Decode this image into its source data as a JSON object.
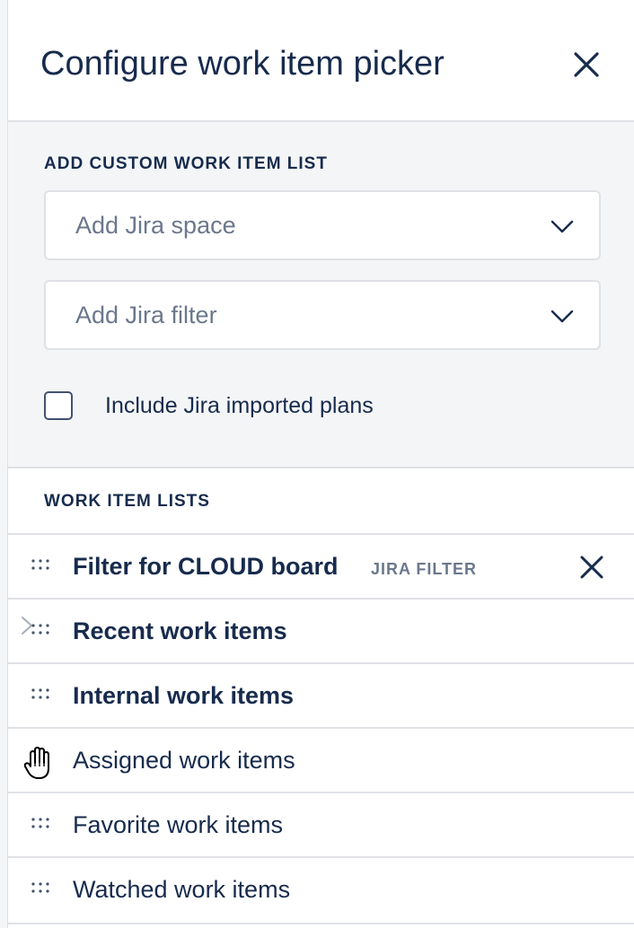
{
  "dialog": {
    "title": "Configure work item picker",
    "close_icon": "close-icon"
  },
  "custom_list": {
    "heading": "ADD CUSTOM WORK ITEM LIST",
    "space_select": {
      "placeholder": "Add Jira space",
      "icon": "chevron-down-icon"
    },
    "filter_select": {
      "placeholder": "Add Jira filter",
      "icon": "chevron-down-icon"
    },
    "include_imported": {
      "label": "Include Jira imported plans",
      "checked": false
    }
  },
  "work_item_lists": {
    "heading": "WORK ITEM LISTS",
    "items": [
      {
        "label": "Filter for CLOUD board",
        "tag": "JIRA FILTER",
        "bold": true,
        "removable": true
      },
      {
        "label": "Recent work items",
        "bold": true
      },
      {
        "label": "Internal work items",
        "bold": true
      },
      {
        "label": "Assigned work items",
        "bold": false
      },
      {
        "label": "Favorite work items",
        "bold": false
      },
      {
        "label": "Watched work items",
        "bold": false
      }
    ]
  },
  "colors": {
    "text": "#172b4d",
    "subtle_text": "#6b778c",
    "border": "#dfe1e6",
    "section_bg": "#f4f5f7"
  }
}
